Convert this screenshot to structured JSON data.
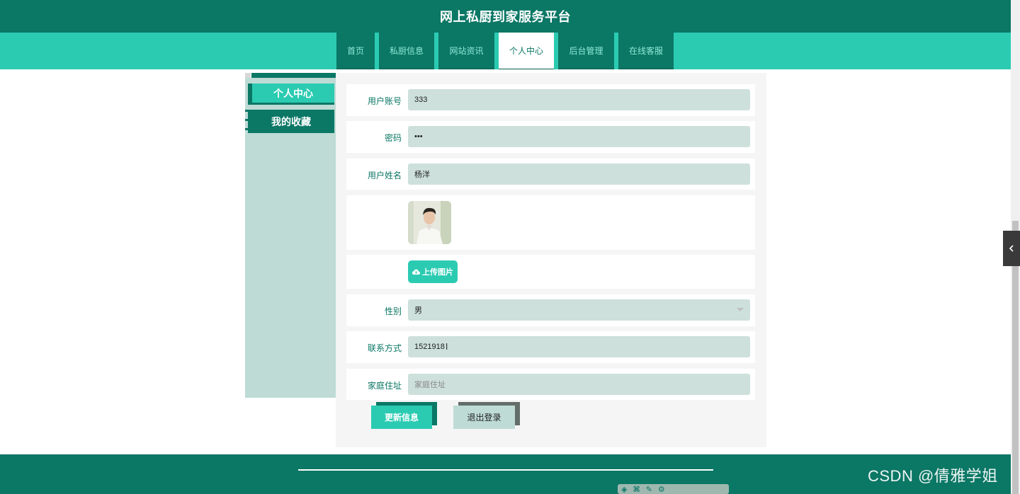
{
  "app": {
    "title": "网上私厨到家服务平台"
  },
  "nav": {
    "items": [
      {
        "label": "首页"
      },
      {
        "label": "私厨信息"
      },
      {
        "label": "网站资讯"
      },
      {
        "label": "个人中心"
      },
      {
        "label": "后台管理"
      },
      {
        "label": "在线客服"
      }
    ],
    "active": "个人中心"
  },
  "sidebar": {
    "items": [
      {
        "label": "个人中心"
      },
      {
        "label": "我的收藏"
      }
    ]
  },
  "form": {
    "account": {
      "label": "用户账号",
      "value": "333"
    },
    "password": {
      "label": "密码",
      "value": "•••"
    },
    "name": {
      "label": "用户姓名",
      "value": "杨洋"
    },
    "upload_label": "上传图片",
    "gender": {
      "label": "性别",
      "value": "男"
    },
    "phone": {
      "label": "联系方式",
      "value": "1521918"
    },
    "address": {
      "label": "家庭住址",
      "placeholder": "家庭住址"
    }
  },
  "buttons": {
    "update": "更新信息",
    "logout": "退出登录"
  },
  "watermark": "CSDN @倩雅学姐",
  "colors": {
    "primary": "#0b7765",
    "accent": "#2bcbb2",
    "field": "#cde0dc",
    "sidebar": "#bedbd5"
  },
  "icons": {
    "upload": "cloud-upload-icon",
    "toggle": "chevron-left-icon",
    "dropdown": "caret-down-icon"
  }
}
